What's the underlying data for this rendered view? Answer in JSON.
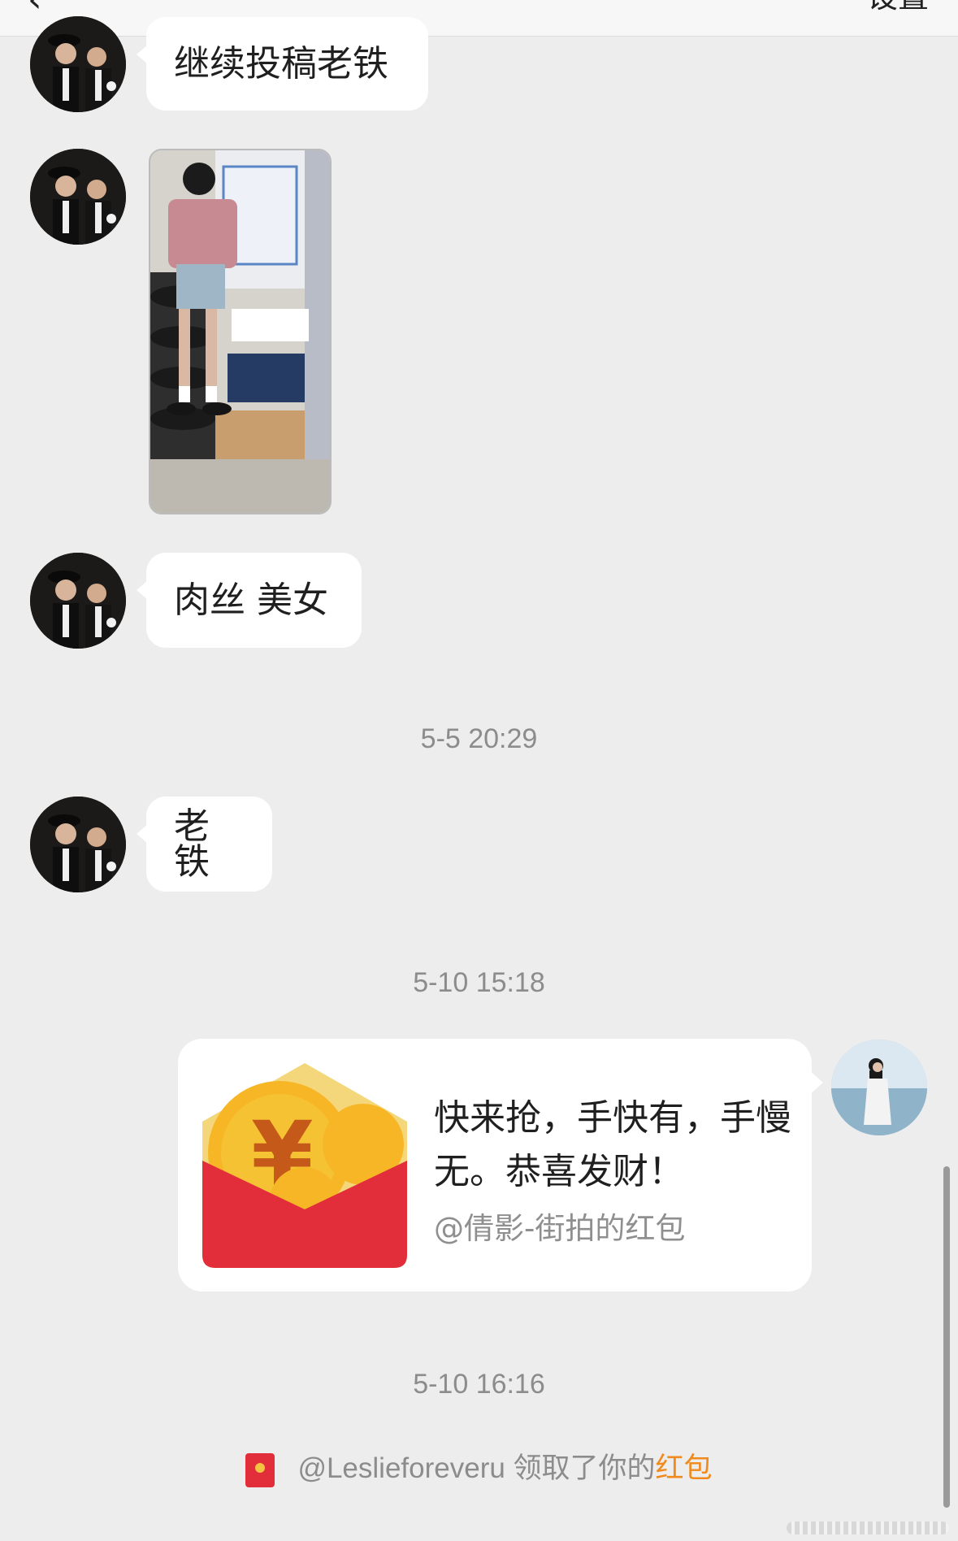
{
  "header": {
    "title": "",
    "back_icon": "chevron-left-icon",
    "settings_label": "设置"
  },
  "messages": [
    {
      "text": "继续投稿老铁"
    },
    {
      "text": "肉丝 美女"
    },
    {
      "text": "老铁"
    }
  ],
  "timestamps": [
    "5-5 20:29",
    "5-10 15:18",
    "5-10 16:16"
  ],
  "red_packet": {
    "message": "快来抢，手快有，手慢无。恭喜发财！",
    "from": "@倩影-街拍的红包",
    "icon": "red-envelope-icon"
  },
  "system_notice": {
    "user": "@Leslieforeveru",
    "action": " 领取了你的",
    "highlight": "红包"
  },
  "colors": {
    "background": "#ededed",
    "bubble": "#ffffff",
    "envelope_red": "#e22e3b",
    "highlight": "#f08a1c"
  }
}
